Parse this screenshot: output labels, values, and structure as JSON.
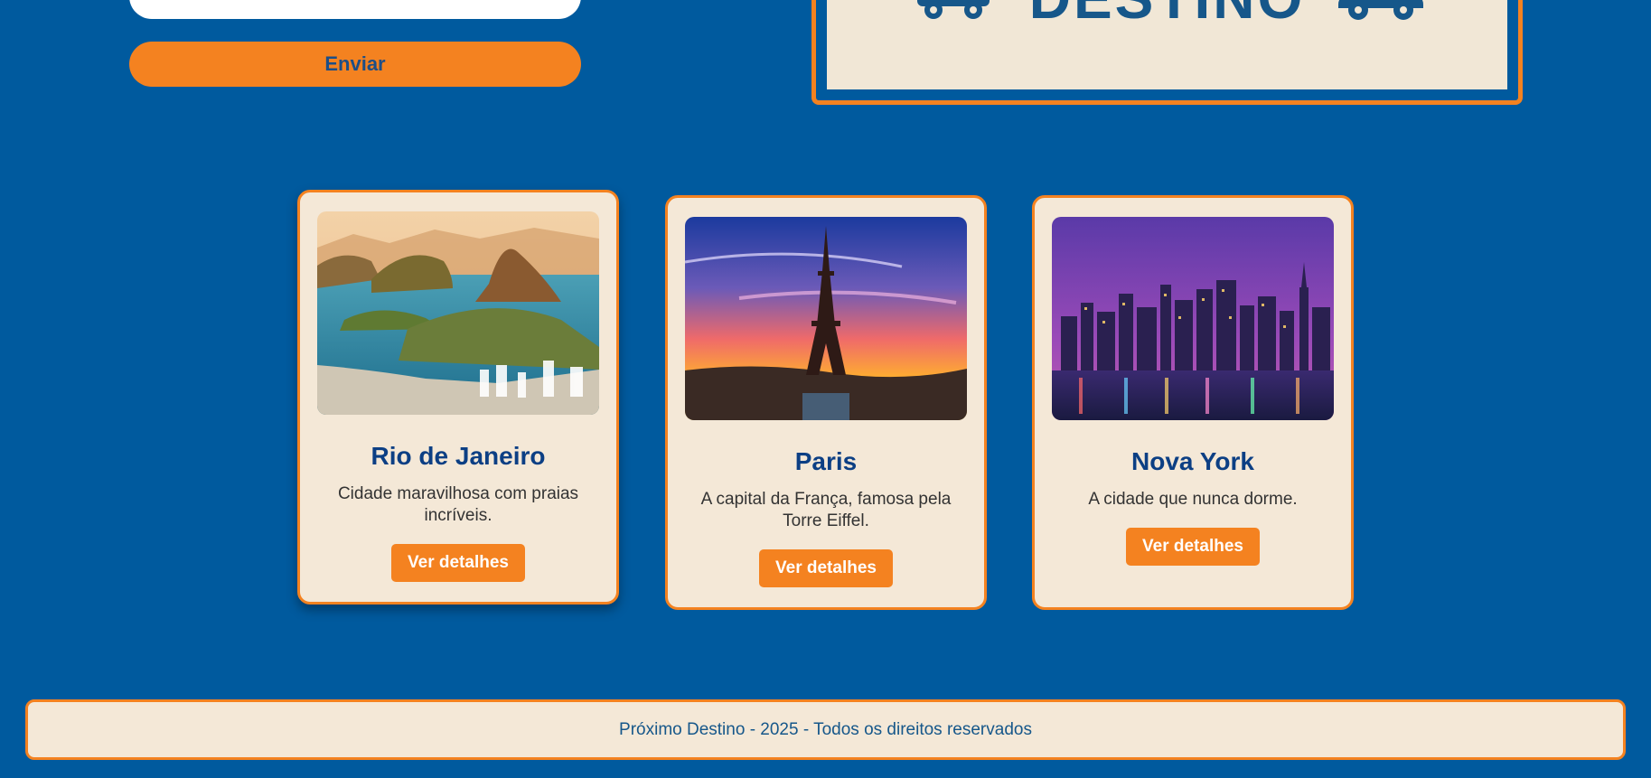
{
  "form": {
    "submit_label": "Enviar"
  },
  "logo": {
    "text": "DESTINO",
    "left_icon": "bus-icon",
    "right_icon": "car-icon"
  },
  "cards": [
    {
      "title": "Rio de Janeiro",
      "description": "Cidade maravilhosa com praias incríveis.",
      "button": "Ver detalhes",
      "image": "rio-de-janeiro-photo"
    },
    {
      "title": "Paris",
      "description": "A capital da França, famosa pela Torre Eiffel.",
      "button": "Ver detalhes",
      "image": "eiffel-tower-sunset-photo"
    },
    {
      "title": "Nova York",
      "description": "A cidade que nunca dorme.",
      "button": "Ver detalhes",
      "image": "new-york-skyline-night-photo"
    }
  ],
  "footer": {
    "text": "Próximo Destino - 2025 - Todos os direitos reservados"
  },
  "colors": {
    "background": "#005a9e",
    "accent": "#f48220",
    "card_bg": "#f4e8d7",
    "title": "#0c3f84"
  }
}
